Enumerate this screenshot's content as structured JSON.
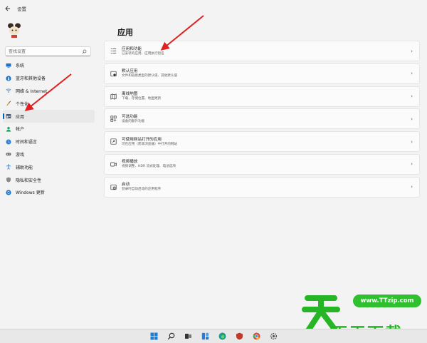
{
  "window": {
    "title": "设置"
  },
  "search": {
    "placeholder": "查找设置"
  },
  "sidebar": {
    "items": [
      {
        "label": "系统",
        "icon": "monitor-icon"
      },
      {
        "label": "蓝牙和其他设备",
        "icon": "bluetooth-icon"
      },
      {
        "label": "网络 & Internet",
        "icon": "wifi-icon"
      },
      {
        "label": "个性化",
        "icon": "brush-icon"
      },
      {
        "label": "应用",
        "icon": "apps-icon",
        "active": true
      },
      {
        "label": "帐户",
        "icon": "user-icon"
      },
      {
        "label": "时间和语言",
        "icon": "globe-clock-icon"
      },
      {
        "label": "游戏",
        "icon": "gamepad-icon"
      },
      {
        "label": "辅助功能",
        "icon": "accessibility-icon"
      },
      {
        "label": "隐私和安全性",
        "icon": "shield-icon"
      },
      {
        "label": "Windows 更新",
        "icon": "update-icon"
      }
    ]
  },
  "main": {
    "title": "应用",
    "cards": [
      {
        "title": "应用和功能",
        "subtitle": "已安装的应用、应用执行别名",
        "icon": "list-icon"
      },
      {
        "title": "默认应用",
        "subtitle": "文件和链接类型的默认值、其他默认值",
        "icon": "default-app-icon"
      },
      {
        "title": "离线地图",
        "subtitle": "下载、存储位置、地图更新",
        "icon": "map-icon"
      },
      {
        "title": "可选功能",
        "subtitle": "设备的额外功能",
        "icon": "optional-features-icon"
      },
      {
        "title": "可使用网站打开的应用",
        "subtitle": "可在应用（而非浏览器）中打开的网站",
        "icon": "web-app-icon"
      },
      {
        "title": "视频播放",
        "subtitle": "视频调整、HDR 流式处理、电池选项",
        "icon": "video-icon"
      },
      {
        "title": "启动",
        "subtitle": "登录时自动启动的应用程序",
        "icon": "startup-icon"
      }
    ]
  },
  "taskbar": {
    "icons": [
      "start-icon",
      "search-icon",
      "task-view-icon",
      "widgets-icon",
      "edge-icon",
      "security-icon",
      "chrome-icon",
      "settings-icon"
    ]
  },
  "watermark": {
    "url": "www.TTzip.com",
    "brand": "天天下载"
  },
  "colors": {
    "accent": "#005fb8",
    "watermark_green": "#25b525",
    "annotation_red": "#e02020"
  }
}
